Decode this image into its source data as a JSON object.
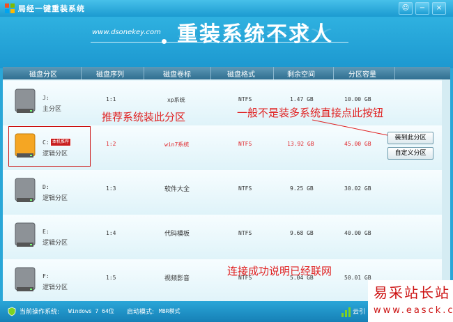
{
  "window": {
    "title": "局经一键重装系统",
    "buttons": {
      "feedback": "☺",
      "minimize": "−",
      "close": "×"
    }
  },
  "banner": {
    "url": "www.dsonekey.com",
    "slogan": "重装系统不求人"
  },
  "table": {
    "headers": [
      "磁盘分区",
      "磁盘序列",
      "磁盘卷标",
      "磁盘格式",
      "剩余空间",
      "分区容量"
    ],
    "rows": [
      {
        "letter": "J:",
        "type": "主分区",
        "seq": "1:1",
        "label": "xp系统",
        "format": "NTFS",
        "free": "1.47 GB",
        "size": "10.00 GB",
        "highlight": false,
        "badge": ""
      },
      {
        "letter": "C:",
        "type": "逻辑分区",
        "seq": "1:2",
        "label": "win7系统",
        "format": "NTFS",
        "free": "13.92 GB",
        "size": "45.00 GB",
        "highlight": true,
        "badge": "本机推荐"
      },
      {
        "letter": "D:",
        "type": "逻辑分区",
        "seq": "1:3",
        "label": "软件大全",
        "format": "NTFS",
        "free": "9.25 GB",
        "size": "30.02 GB",
        "highlight": false,
        "badge": ""
      },
      {
        "letter": "E:",
        "type": "逻辑分区",
        "seq": "1:4",
        "label": "代码模板",
        "format": "NTFS",
        "free": "9.68 GB",
        "size": "40.00 GB",
        "highlight": false,
        "badge": ""
      },
      {
        "letter": "F:",
        "type": "逻辑分区",
        "seq": "1:5",
        "label": "视频影音",
        "format": "NTFS",
        "free": "5.04 GB",
        "size": "50.01 GB",
        "highlight": false,
        "badge": ""
      }
    ]
  },
  "actions": {
    "install_here": "装到此分区",
    "custom_partition": "自定义分区"
  },
  "annotations": {
    "recommend": "推荐系统装此分区",
    "button_tip": "一般不是装多系统直接点此按钮",
    "connected": "连接成功说明已经联网"
  },
  "status": {
    "current_os_label": "当前操作系统:",
    "current_os_value": "Windows 7 64位",
    "boot_mode_label": "启动模式:",
    "boot_mode_value": "MBR模式",
    "cloud": "云引"
  },
  "watermark": {
    "title": "易采站长站",
    "url": "www.easck.com"
  },
  "colors": {
    "accent": "#2aa7d8",
    "annotation": "#e02020",
    "highlight_row_text": "#e0262b"
  }
}
